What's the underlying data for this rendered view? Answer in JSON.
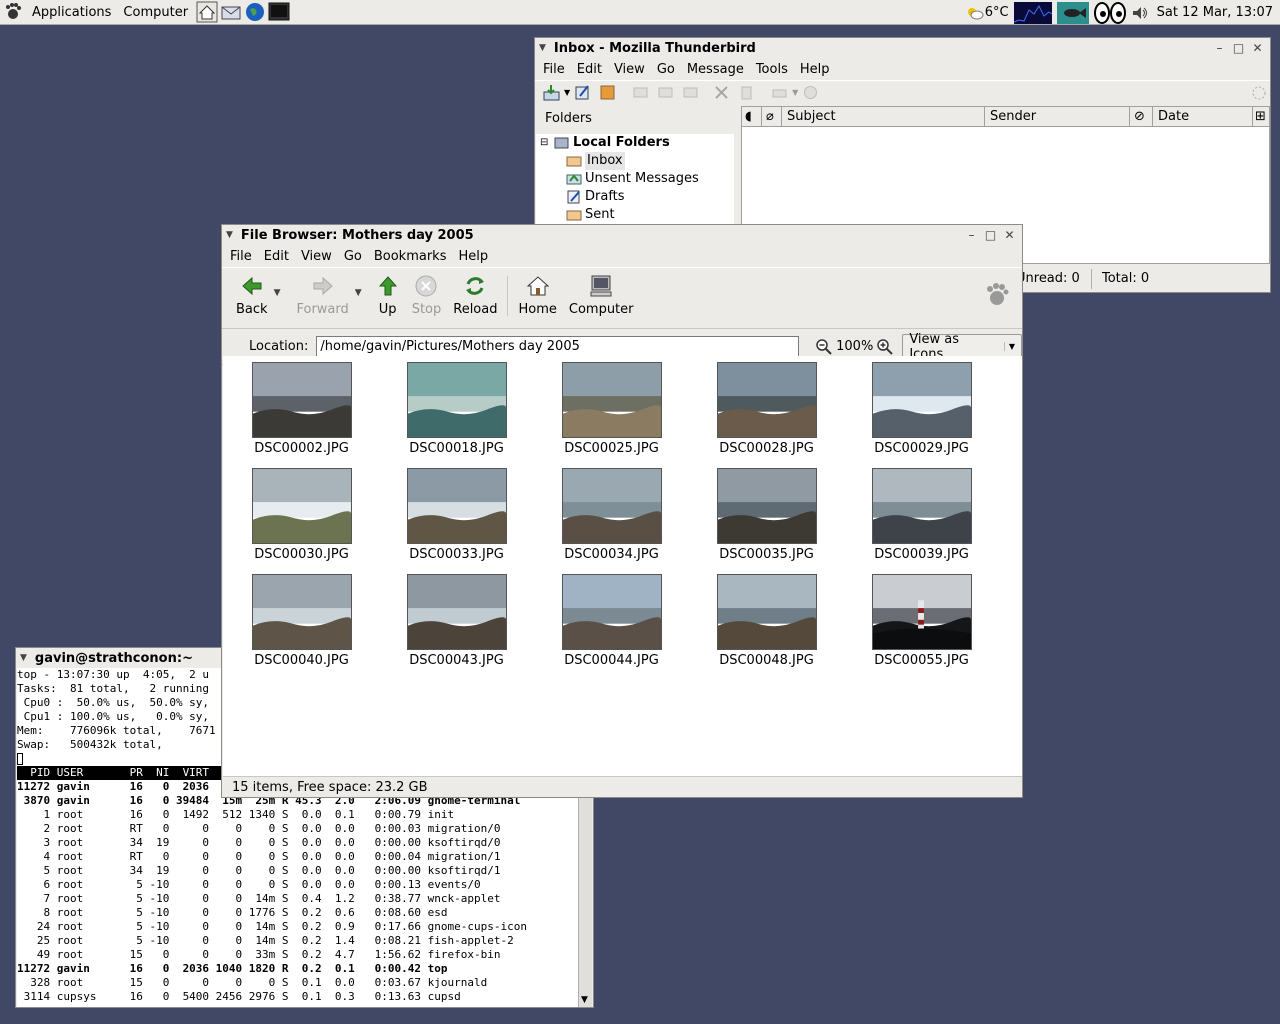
{
  "panel": {
    "applications": "Applications",
    "computer": "Computer",
    "weather": "6°C",
    "datetime": "Sat 12 Mar, 13:07"
  },
  "thunderbird": {
    "title": "Inbox - Mozilla Thunderbird",
    "menu": [
      "File",
      "Edit",
      "View",
      "Go",
      "Message",
      "Tools",
      "Help"
    ],
    "folders_header": "Folders",
    "folders": [
      "Local Folders",
      "Inbox",
      "Unsent Messages",
      "Drafts",
      "Sent"
    ],
    "columns": [
      "Subject",
      "Sender",
      "Date"
    ],
    "unread": "Unread: 0",
    "total": "Total: 0"
  },
  "filebrowser": {
    "title": "File Browser: Mothers day 2005",
    "menu": [
      "File",
      "Edit",
      "View",
      "Go",
      "Bookmarks",
      "Help"
    ],
    "toolbar": {
      "back": "Back",
      "forward": "Forward",
      "up": "Up",
      "stop": "Stop",
      "reload": "Reload",
      "home": "Home",
      "computer": "Computer"
    },
    "location_label": "Location:",
    "location_value": "/home/gavin/Pictures/Mothers day 2005",
    "zoom": "100%",
    "view_as": "View as Icons",
    "files": [
      "DSC00002.JPG",
      "DSC00018.JPG",
      "DSC00025.JPG",
      "DSC00028.JPG",
      "DSC00029.JPG",
      "DSC00030.JPG",
      "DSC00033.JPG",
      "DSC00034.JPG",
      "DSC00035.JPG",
      "DSC00039.JPG",
      "DSC00040.JPG",
      "DSC00043.JPG",
      "DSC00044.JPG",
      "DSC00048.JPG",
      "DSC00055.JPG"
    ],
    "status": "15 items, Free space: 23.2 GB"
  },
  "terminal": {
    "title": "gavin@strathconon:~",
    "lines": [
      "top - 13:07:30 up  4:05,  2 u",
      "Tasks:  81 total,   2 running",
      " Cpu0 :  50.0% us,  50.0% sy,",
      " Cpu1 : 100.0% us,   0.0% sy,",
      "Mem:    776096k total,    7671",
      "Swap:   500432k total,",
      ""
    ],
    "header": "  PID USER       PR  NI  VIRT",
    "processes": [
      "11272 gavin      16   0  2036",
      " 3870 gavin      16   0 39484  15m  25m R 45.3  2.0   2:06.09 gnome-terminal",
      "    1 root       16   0  1492  512 1340 S  0.0  0.1   0:00.79 init",
      "    2 root       RT   0     0    0    0 S  0.0  0.0   0:00.03 migration/0",
      "    3 root       34  19     0    0    0 S  0.0  0.0   0:00.00 ksoftirqd/0",
      "    4 root       RT   0     0    0    0 S  0.0  0.0   0:00.04 migration/1",
      "    5 root       34  19     0    0    0 S  0.0  0.0   0:00.00 ksoftirqd/1",
      "    6 root        5 -10     0    0    0 S  0.0  0.0   0:00.13 events/0",
      "    7 root        5 -10     0    0  14m S  0.4  1.2   0:38.77 wnck-applet",
      "    8 root        5 -10     0    0 1776 S  0.2  0.6   0:08.60 esd",
      "   24 root        5 -10     0    0  14m S  0.2  0.9   0:17.66 gnome-cups-icon",
      "   25 root        5 -10     0    0  14m S  0.2  1.4   0:08.21 fish-applet-2",
      "   49 root       15   0     0    0  33m S  0.2  4.7   1:56.62 firefox-bin",
      "11272 gavin      16   0  2036 1040 1820 R  0.2  0.1   0:00.42 top",
      "  328 root       15   0     0    0    0 S  0.1  0.0   0:03.67 kjournald",
      " 3114 cupsys     16   0  5400 2456 2976 S  0.1  0.3   0:13.63 cupsd"
    ]
  }
}
